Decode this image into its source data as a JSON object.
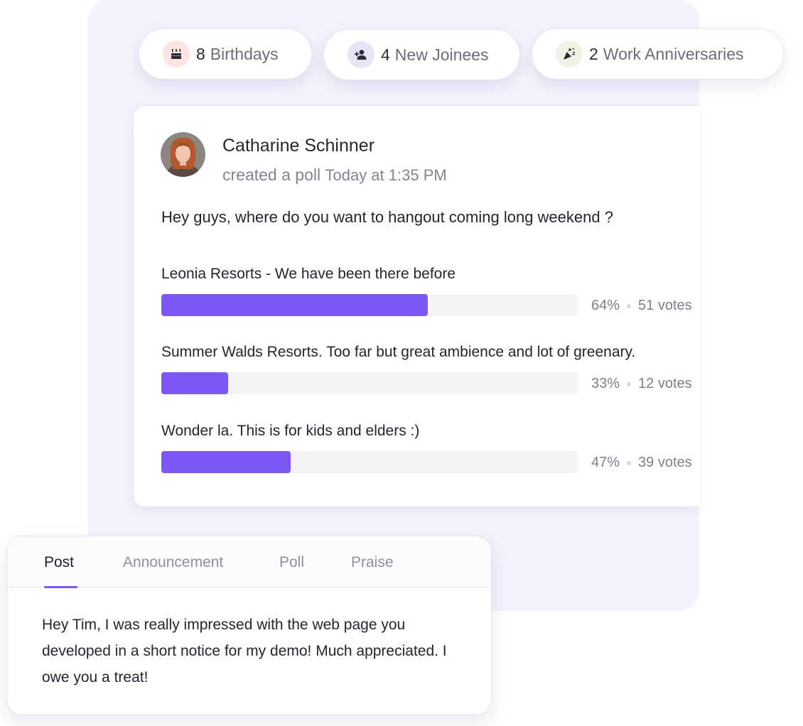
{
  "chips": {
    "birthdays": {
      "count": "8",
      "label": "Birthdays",
      "icon": "cake-icon"
    },
    "joinees": {
      "count": "4",
      "label": "New Joinees",
      "icon": "add-user-icon"
    },
    "anniversaries": {
      "count": "2",
      "label": "Work Anniversaries",
      "icon": "party-popper-icon"
    }
  },
  "poll": {
    "author": "Catharine Schinner",
    "action": "created a poll",
    "time": "Today at 1:35 PM",
    "question": "Hey guys, where do you want to hangout coming long weekend ?",
    "options": [
      {
        "label": "Leonia Resorts - We have been there before",
        "percent": "64%",
        "votes": "51 votes",
        "fill": 0.64
      },
      {
        "label": "Summer Walds Resorts. Too far but great ambience and lot of greenary.",
        "percent": "33%",
        "votes": "12 votes",
        "fill": 0.16
      },
      {
        "label": "Wonder la. This is for kids and elders :)",
        "percent": "47%",
        "votes": "39 votes",
        "fill": 0.31
      }
    ]
  },
  "composer": {
    "tabs": [
      "Post",
      "Announcement",
      "Poll",
      "Praise"
    ],
    "active_tab": "Post",
    "text": "Hey Tim, I was really impressed with the web page you developed in a short notice for my demo! Much appreciated. I owe you a treat!"
  },
  "colors": {
    "accent": "#7d58f4",
    "panel": "#f4f2fd"
  }
}
